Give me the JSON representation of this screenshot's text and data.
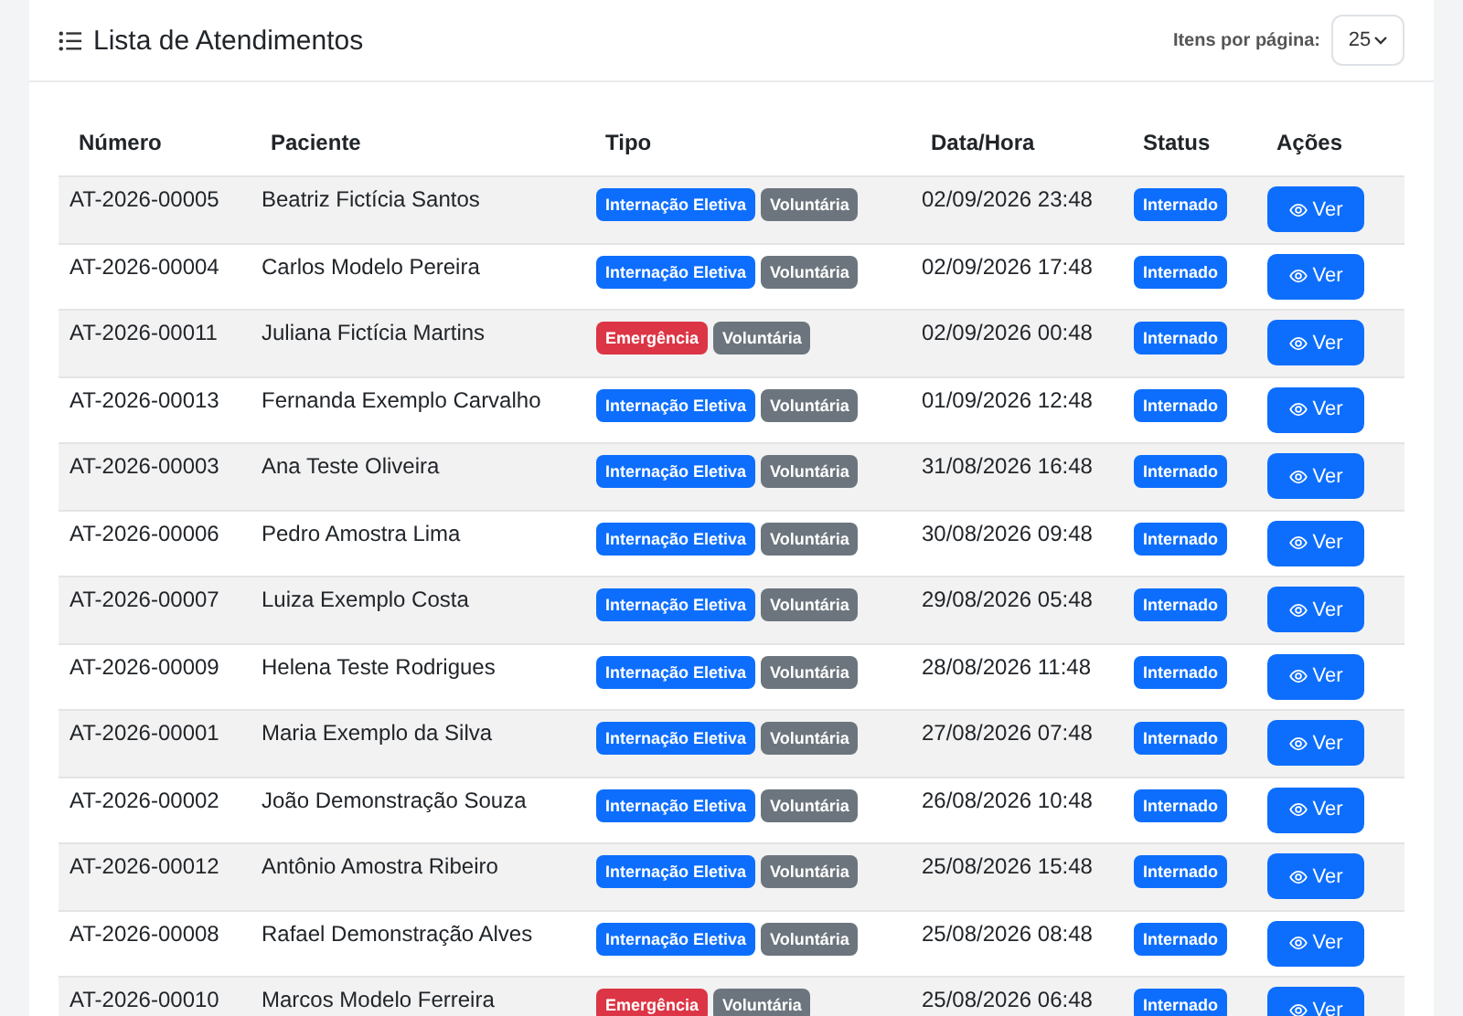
{
  "header": {
    "title": "Lista de Atendimentos",
    "page_size_label": "Itens por página:",
    "page_size": "25"
  },
  "table": {
    "columns": [
      "Número",
      "Paciente",
      "Tipo",
      "Data/Hora",
      "Status",
      "Ações"
    ],
    "rows": [
      {
        "numero": "AT-2026-00005",
        "paciente": "Beatriz Fictícia Santos",
        "tipo": [
          {
            "label": "Internação Eletiva",
            "color": "#0d6efd"
          },
          {
            "label": "Voluntária",
            "color": "#6c757d"
          }
        ],
        "data": "02/09/2026 23:48",
        "status": {
          "label": "Internado",
          "color": "#0d6efd"
        },
        "action": "Ver"
      },
      {
        "numero": "AT-2026-00004",
        "paciente": "Carlos Modelo Pereira",
        "tipo": [
          {
            "label": "Internação Eletiva",
            "color": "#0d6efd"
          },
          {
            "label": "Voluntária",
            "color": "#6c757d"
          }
        ],
        "data": "02/09/2026 17:48",
        "status": {
          "label": "Internado",
          "color": "#0d6efd"
        },
        "action": "Ver"
      },
      {
        "numero": "AT-2026-00011",
        "paciente": "Juliana Fictícia Martins",
        "tipo": [
          {
            "label": "Emergência",
            "color": "#dc3545"
          },
          {
            "label": "Voluntária",
            "color": "#6c757d"
          }
        ],
        "data": "02/09/2026 00:48",
        "status": {
          "label": "Internado",
          "color": "#0d6efd"
        },
        "action": "Ver"
      },
      {
        "numero": "AT-2026-00013",
        "paciente": "Fernanda Exemplo Carvalho",
        "tipo": [
          {
            "label": "Internação Eletiva",
            "color": "#0d6efd"
          },
          {
            "label": "Voluntária",
            "color": "#6c757d"
          }
        ],
        "data": "01/09/2026 12:48",
        "status": {
          "label": "Internado",
          "color": "#0d6efd"
        },
        "action": "Ver"
      },
      {
        "numero": "AT-2026-00003",
        "paciente": "Ana Teste Oliveira",
        "tipo": [
          {
            "label": "Internação Eletiva",
            "color": "#0d6efd"
          },
          {
            "label": "Voluntária",
            "color": "#6c757d"
          }
        ],
        "data": "31/08/2026 16:48",
        "status": {
          "label": "Internado",
          "color": "#0d6efd"
        },
        "action": "Ver"
      },
      {
        "numero": "AT-2026-00006",
        "paciente": "Pedro Amostra Lima",
        "tipo": [
          {
            "label": "Internação Eletiva",
            "color": "#0d6efd"
          },
          {
            "label": "Voluntária",
            "color": "#6c757d"
          }
        ],
        "data": "30/08/2026 09:48",
        "status": {
          "label": "Internado",
          "color": "#0d6efd"
        },
        "action": "Ver"
      },
      {
        "numero": "AT-2026-00007",
        "paciente": "Luiza Exemplo Costa",
        "tipo": [
          {
            "label": "Internação Eletiva",
            "color": "#0d6efd"
          },
          {
            "label": "Voluntária",
            "color": "#6c757d"
          }
        ],
        "data": "29/08/2026 05:48",
        "status": {
          "label": "Internado",
          "color": "#0d6efd"
        },
        "action": "Ver"
      },
      {
        "numero": "AT-2026-00009",
        "paciente": "Helena Teste Rodrigues",
        "tipo": [
          {
            "label": "Internação Eletiva",
            "color": "#0d6efd"
          },
          {
            "label": "Voluntária",
            "color": "#6c757d"
          }
        ],
        "data": "28/08/2026 11:48",
        "status": {
          "label": "Internado",
          "color": "#0d6efd"
        },
        "action": "Ver"
      },
      {
        "numero": "AT-2026-00001",
        "paciente": "Maria Exemplo da Silva",
        "tipo": [
          {
            "label": "Internação Eletiva",
            "color": "#0d6efd"
          },
          {
            "label": "Voluntária",
            "color": "#6c757d"
          }
        ],
        "data": "27/08/2026 07:48",
        "status": {
          "label": "Internado",
          "color": "#0d6efd"
        },
        "action": "Ver"
      },
      {
        "numero": "AT-2026-00002",
        "paciente": "João Demonstração Souza",
        "tipo": [
          {
            "label": "Internação Eletiva",
            "color": "#0d6efd"
          },
          {
            "label": "Voluntária",
            "color": "#6c757d"
          }
        ],
        "data": "26/08/2026 10:48",
        "status": {
          "label": "Internado",
          "color": "#0d6efd"
        },
        "action": "Ver"
      },
      {
        "numero": "AT-2026-00012",
        "paciente": "Antônio Amostra Ribeiro",
        "tipo": [
          {
            "label": "Internação Eletiva",
            "color": "#0d6efd"
          },
          {
            "label": "Voluntária",
            "color": "#6c757d"
          }
        ],
        "data": "25/08/2026 15:48",
        "status": {
          "label": "Internado",
          "color": "#0d6efd"
        },
        "action": "Ver"
      },
      {
        "numero": "AT-2026-00008",
        "paciente": "Rafael Demonstração Alves",
        "tipo": [
          {
            "label": "Internação Eletiva",
            "color": "#0d6efd"
          },
          {
            "label": "Voluntária",
            "color": "#6c757d"
          }
        ],
        "data": "25/08/2026 08:48",
        "status": {
          "label": "Internado",
          "color": "#0d6efd"
        },
        "action": "Ver"
      },
      {
        "numero": "AT-2026-00010",
        "paciente": "Marcos Modelo Ferreira",
        "tipo": [
          {
            "label": "Emergência",
            "color": "#dc3545"
          },
          {
            "label": "Voluntária",
            "color": "#6c757d"
          }
        ],
        "data": "25/08/2026 06:48",
        "status": {
          "label": "Internado",
          "color": "#0d6efd"
        },
        "action": "Ver"
      }
    ]
  }
}
